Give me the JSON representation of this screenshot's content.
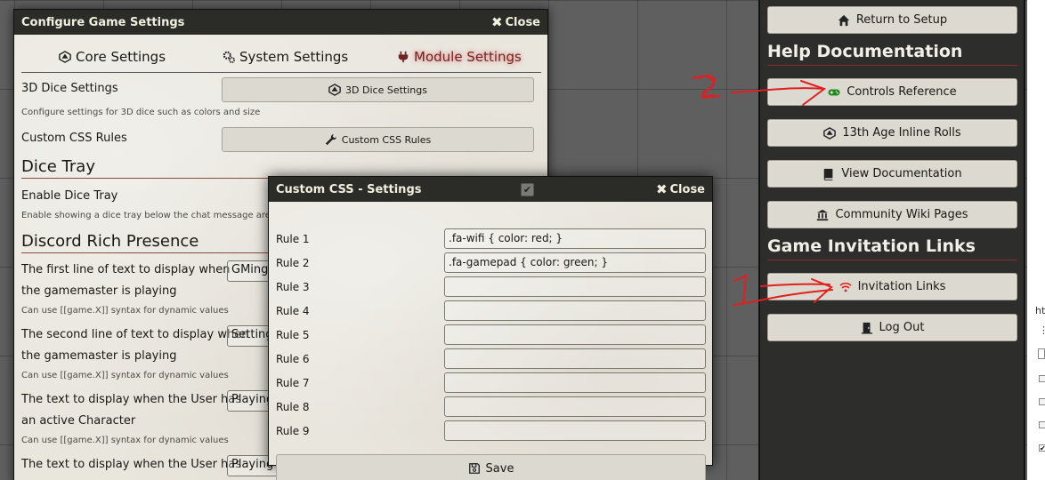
{
  "config_window": {
    "title": "Configure Game Settings",
    "close_label": "Close",
    "tabs": [
      {
        "label": "Core Settings",
        "icon": "d20-icon"
      },
      {
        "label": "System Settings",
        "icon": "cogs-icon"
      },
      {
        "label": "Module Settings",
        "icon": "plug-icon",
        "active": true
      }
    ],
    "dice_3d": {
      "label": "3D Dice Settings",
      "button": "3D Dice Settings",
      "hint": "Configure settings for 3D dice such as colors and size"
    },
    "custom_css": {
      "label": "Custom CSS Rules",
      "button": "Custom CSS Rules"
    },
    "dice_tray": {
      "heading": "Dice Tray",
      "label": "Enable Dice Tray",
      "hint": "Enable showing a dice tray below the chat message area"
    },
    "discord": {
      "heading": "Discord Rich Presence",
      "items": [
        {
          "line1": "The first line of text to display when",
          "line2": "the gamemaster is playing",
          "value": "GMing",
          "hint": "Can use [[game.X]] syntax for dynamic values"
        },
        {
          "line1": "The second line of text to display when",
          "line2": "the gamemaster is playing",
          "value": "Setting",
          "hint": "Can use [[game.X]] syntax for dynamic values"
        },
        {
          "line1": "The text to display when the User has",
          "line2": "an active Character",
          "value": "Playing",
          "hint": "Can use [[game.X]] syntax for dynamic values"
        },
        {
          "line1": "The text to display when the User has",
          "line2": "",
          "value": "Playing [[game.system.data.title]]",
          "hint": ""
        }
      ]
    }
  },
  "css_dialog": {
    "title": "Custom CSS - Settings",
    "close_label": "Close",
    "rules": [
      {
        "label": "Rule 1",
        "value": ".fa-wifi { color: red; }"
      },
      {
        "label": "Rule 2",
        "value": ".fa-gamepad { color: green; }"
      },
      {
        "label": "Rule 3",
        "value": ""
      },
      {
        "label": "Rule 4",
        "value": ""
      },
      {
        "label": "Rule 5",
        "value": ""
      },
      {
        "label": "Rule 6",
        "value": ""
      },
      {
        "label": "Rule 7",
        "value": ""
      },
      {
        "label": "Rule 8",
        "value": ""
      },
      {
        "label": "Rule 9",
        "value": ""
      }
    ],
    "save_label": "Save"
  },
  "sidebar": {
    "return_label": "Return to Setup",
    "help_heading": "Help Documentation",
    "help_items": [
      {
        "label": "Controls Reference",
        "icon": "gamepad-icon"
      },
      {
        "label": "13th Age Inline Rolls",
        "icon": "d20-icon"
      },
      {
        "label": "View Documentation",
        "icon": "book-icon"
      },
      {
        "label": "Community Wiki Pages",
        "icon": "landmark-icon"
      }
    ],
    "invite_heading": "Game Invitation Links",
    "invite_label": "Invitation Links",
    "logout_label": "Log Out"
  },
  "devtools_fragment": {
    "text": "ht"
  },
  "annotations": {
    "arrow1_number": "1",
    "arrow2_number": "2"
  },
  "colors": {
    "wifi_icon": "#e02020",
    "gamepad_icon": "#1f8a1f",
    "annotation": "#e02020",
    "active_tab": "#6d2424"
  }
}
